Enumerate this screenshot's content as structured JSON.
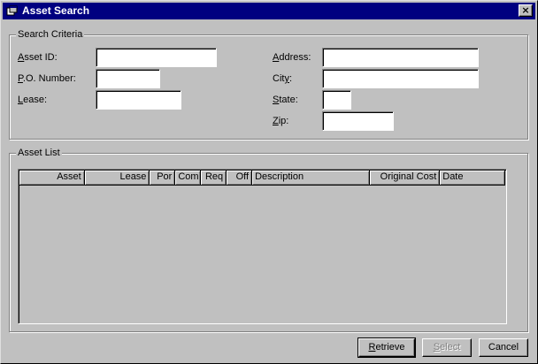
{
  "window": {
    "title": "Asset Search",
    "icon": "window-app-icon",
    "close_label": "×"
  },
  "criteria": {
    "legend": "Search Criteria",
    "asset_id": {
      "label_pre": "",
      "label_accel": "A",
      "label_post": "sset ID:",
      "value": ""
    },
    "po_number": {
      "label_pre": "",
      "label_accel": "P",
      "label_post": ".O. Number:",
      "value": ""
    },
    "lease": {
      "label_pre": "",
      "label_accel": "L",
      "label_post": "ease:",
      "value": ""
    },
    "address": {
      "label_pre": "",
      "label_accel": "A",
      "label_post": "ddress:",
      "value": ""
    },
    "city": {
      "label_pre": "Cit",
      "label_accel": "y",
      "label_post": ":",
      "value": ""
    },
    "state": {
      "label_pre": "",
      "label_accel": "S",
      "label_post": "tate:",
      "value": ""
    },
    "zip": {
      "label_pre": "",
      "label_accel": "Z",
      "label_post": "ip:",
      "value": ""
    }
  },
  "asset_list": {
    "legend": "Asset List",
    "columns": [
      "Asset",
      "Lease",
      "Por",
      "Com",
      "Req",
      "Off",
      "Description",
      "Original Cost",
      "Date"
    ],
    "rows": []
  },
  "buttons": {
    "retrieve": {
      "pre": "",
      "accel": "R",
      "post": "etrieve"
    },
    "select": {
      "pre": "",
      "accel": "S",
      "post": "elect"
    },
    "cancel": {
      "label": "Cancel"
    }
  }
}
